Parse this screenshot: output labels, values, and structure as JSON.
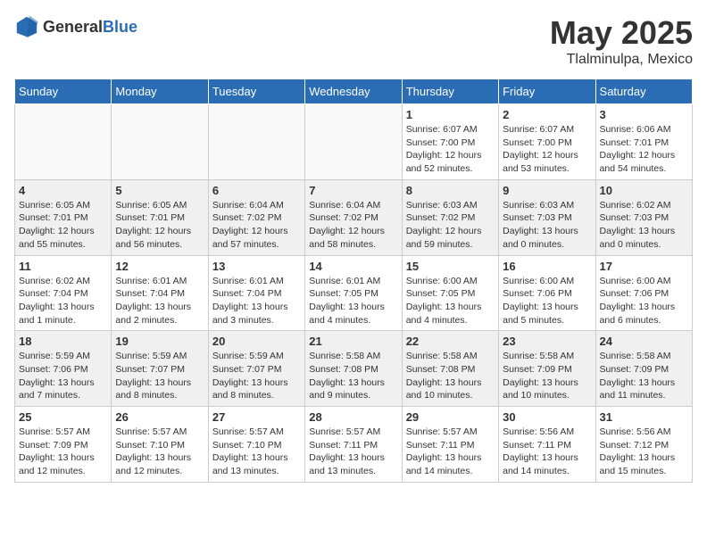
{
  "header": {
    "logo_general": "General",
    "logo_blue": "Blue",
    "month": "May 2025",
    "location": "Tlalminulpa, Mexico"
  },
  "days_of_week": [
    "Sunday",
    "Monday",
    "Tuesday",
    "Wednesday",
    "Thursday",
    "Friday",
    "Saturday"
  ],
  "weeks": [
    [
      {
        "day": "",
        "info": ""
      },
      {
        "day": "",
        "info": ""
      },
      {
        "day": "",
        "info": ""
      },
      {
        "day": "",
        "info": ""
      },
      {
        "day": "1",
        "info": "Sunrise: 6:07 AM\nSunset: 7:00 PM\nDaylight: 12 hours\nand 52 minutes."
      },
      {
        "day": "2",
        "info": "Sunrise: 6:07 AM\nSunset: 7:00 PM\nDaylight: 12 hours\nand 53 minutes."
      },
      {
        "day": "3",
        "info": "Sunrise: 6:06 AM\nSunset: 7:01 PM\nDaylight: 12 hours\nand 54 minutes."
      }
    ],
    [
      {
        "day": "4",
        "info": "Sunrise: 6:05 AM\nSunset: 7:01 PM\nDaylight: 12 hours\nand 55 minutes."
      },
      {
        "day": "5",
        "info": "Sunrise: 6:05 AM\nSunset: 7:01 PM\nDaylight: 12 hours\nand 56 minutes."
      },
      {
        "day": "6",
        "info": "Sunrise: 6:04 AM\nSunset: 7:02 PM\nDaylight: 12 hours\nand 57 minutes."
      },
      {
        "day": "7",
        "info": "Sunrise: 6:04 AM\nSunset: 7:02 PM\nDaylight: 12 hours\nand 58 minutes."
      },
      {
        "day": "8",
        "info": "Sunrise: 6:03 AM\nSunset: 7:02 PM\nDaylight: 12 hours\nand 59 minutes."
      },
      {
        "day": "9",
        "info": "Sunrise: 6:03 AM\nSunset: 7:03 PM\nDaylight: 13 hours\nand 0 minutes."
      },
      {
        "day": "10",
        "info": "Sunrise: 6:02 AM\nSunset: 7:03 PM\nDaylight: 13 hours\nand 0 minutes."
      }
    ],
    [
      {
        "day": "11",
        "info": "Sunrise: 6:02 AM\nSunset: 7:04 PM\nDaylight: 13 hours\nand 1 minute."
      },
      {
        "day": "12",
        "info": "Sunrise: 6:01 AM\nSunset: 7:04 PM\nDaylight: 13 hours\nand 2 minutes."
      },
      {
        "day": "13",
        "info": "Sunrise: 6:01 AM\nSunset: 7:04 PM\nDaylight: 13 hours\nand 3 minutes."
      },
      {
        "day": "14",
        "info": "Sunrise: 6:01 AM\nSunset: 7:05 PM\nDaylight: 13 hours\nand 4 minutes."
      },
      {
        "day": "15",
        "info": "Sunrise: 6:00 AM\nSunset: 7:05 PM\nDaylight: 13 hours\nand 4 minutes."
      },
      {
        "day": "16",
        "info": "Sunrise: 6:00 AM\nSunset: 7:06 PM\nDaylight: 13 hours\nand 5 minutes."
      },
      {
        "day": "17",
        "info": "Sunrise: 6:00 AM\nSunset: 7:06 PM\nDaylight: 13 hours\nand 6 minutes."
      }
    ],
    [
      {
        "day": "18",
        "info": "Sunrise: 5:59 AM\nSunset: 7:06 PM\nDaylight: 13 hours\nand 7 minutes."
      },
      {
        "day": "19",
        "info": "Sunrise: 5:59 AM\nSunset: 7:07 PM\nDaylight: 13 hours\nand 8 minutes."
      },
      {
        "day": "20",
        "info": "Sunrise: 5:59 AM\nSunset: 7:07 PM\nDaylight: 13 hours\nand 8 minutes."
      },
      {
        "day": "21",
        "info": "Sunrise: 5:58 AM\nSunset: 7:08 PM\nDaylight: 13 hours\nand 9 minutes."
      },
      {
        "day": "22",
        "info": "Sunrise: 5:58 AM\nSunset: 7:08 PM\nDaylight: 13 hours\nand 10 minutes."
      },
      {
        "day": "23",
        "info": "Sunrise: 5:58 AM\nSunset: 7:09 PM\nDaylight: 13 hours\nand 10 minutes."
      },
      {
        "day": "24",
        "info": "Sunrise: 5:58 AM\nSunset: 7:09 PM\nDaylight: 13 hours\nand 11 minutes."
      }
    ],
    [
      {
        "day": "25",
        "info": "Sunrise: 5:57 AM\nSunset: 7:09 PM\nDaylight: 13 hours\nand 12 minutes."
      },
      {
        "day": "26",
        "info": "Sunrise: 5:57 AM\nSunset: 7:10 PM\nDaylight: 13 hours\nand 12 minutes."
      },
      {
        "day": "27",
        "info": "Sunrise: 5:57 AM\nSunset: 7:10 PM\nDaylight: 13 hours\nand 13 minutes."
      },
      {
        "day": "28",
        "info": "Sunrise: 5:57 AM\nSunset: 7:11 PM\nDaylight: 13 hours\nand 13 minutes."
      },
      {
        "day": "29",
        "info": "Sunrise: 5:57 AM\nSunset: 7:11 PM\nDaylight: 13 hours\nand 14 minutes."
      },
      {
        "day": "30",
        "info": "Sunrise: 5:56 AM\nSunset: 7:11 PM\nDaylight: 13 hours\nand 14 minutes."
      },
      {
        "day": "31",
        "info": "Sunrise: 5:56 AM\nSunset: 7:12 PM\nDaylight: 13 hours\nand 15 minutes."
      }
    ]
  ]
}
